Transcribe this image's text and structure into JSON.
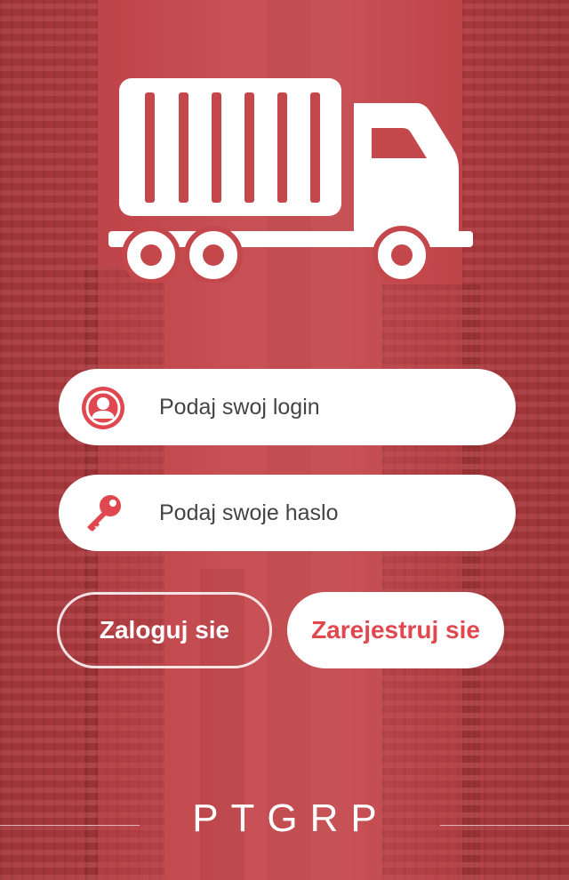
{
  "colors": {
    "background": "#c4474c",
    "accent": "#e0474f",
    "white": "#ffffff"
  },
  "logo": {
    "icon": "truck-icon"
  },
  "login_field": {
    "icon": "user-icon",
    "placeholder": "Podaj swoj login"
  },
  "password_field": {
    "icon": "key-icon",
    "placeholder": "Podaj swoje haslo"
  },
  "buttons": {
    "login_label": "Zaloguj sie",
    "register_label": "Zarejestruj sie"
  },
  "footer": {
    "brand": "PTGRP"
  }
}
